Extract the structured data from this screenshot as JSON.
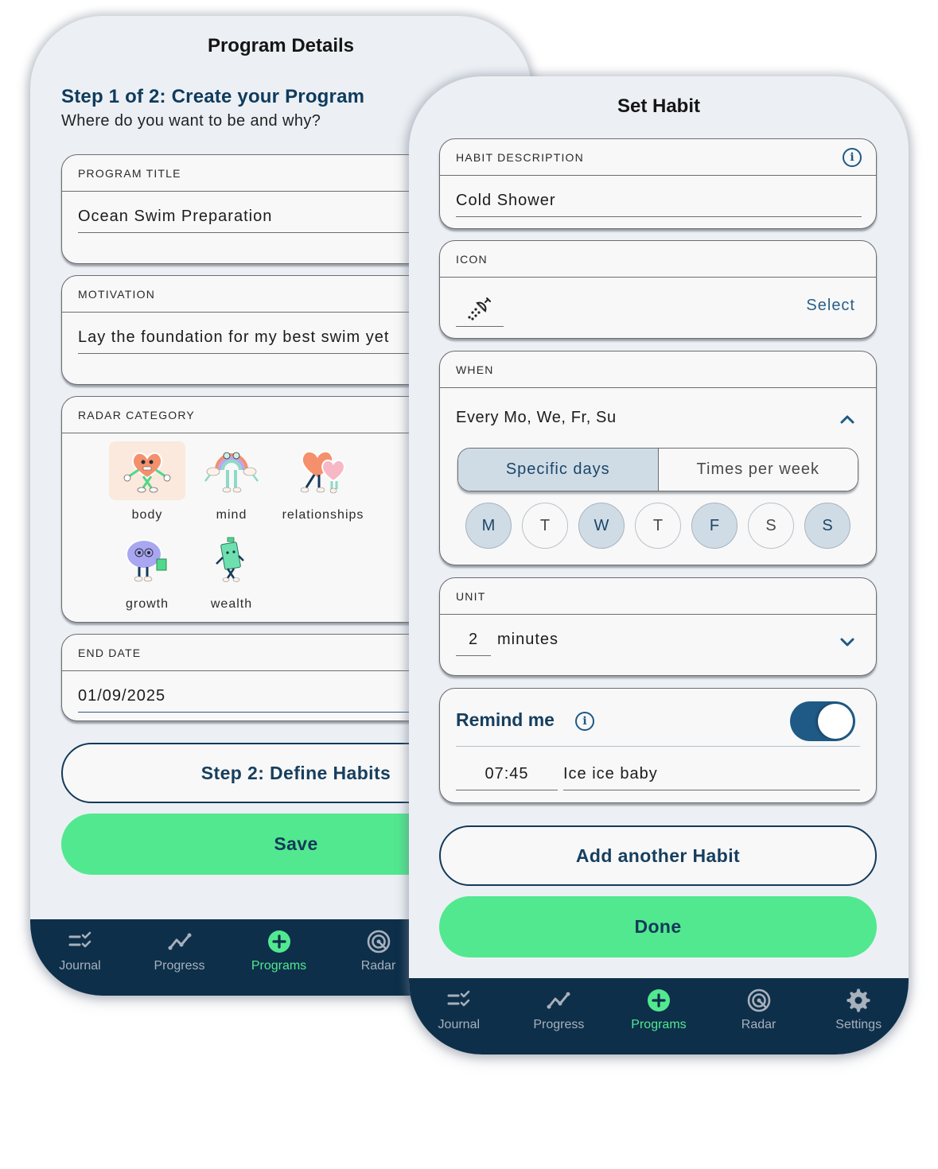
{
  "colors": {
    "accent_green": "#52e890",
    "navy": "#0d2f4a",
    "heading_blue": "#0f3b5c",
    "selected_fill": "#d0dce5",
    "toggle_on": "#1f5a86"
  },
  "program_details": {
    "title": "Program Details",
    "step_heading": "Step 1 of 2: Create your Program",
    "step_subheading": "Where do you want to be and why?",
    "program_title": {
      "label": "PROGRAM TITLE",
      "value": "Ocean Swim Preparation"
    },
    "motivation": {
      "label": "MOTIVATION",
      "value": "Lay the foundation for my best swim yet"
    },
    "radar_category": {
      "label": "RADAR CATEGORY",
      "selected": "body",
      "items": [
        {
          "label": "body",
          "icon": "heart-character-icon"
        },
        {
          "label": "mind",
          "icon": "rainbow-character-icon"
        },
        {
          "label": "relationships",
          "icon": "hugging-hearts-icon"
        },
        {
          "label": "growth",
          "icon": "brain-reading-icon"
        },
        {
          "label": "wealth",
          "icon": "money-character-icon"
        }
      ]
    },
    "end_date": {
      "label": "END DATE",
      "value": "01/09/2025"
    },
    "step2_button": "Step 2: Define Habits",
    "save_button": "Save",
    "tabs": [
      {
        "label": "Journal",
        "icon": "journal-checklist-icon",
        "active": false
      },
      {
        "label": "Progress",
        "icon": "progress-line-icon",
        "active": false
      },
      {
        "label": "Programs",
        "icon": "plus-circle-icon",
        "active": true
      },
      {
        "label": "Radar",
        "icon": "radar-target-icon",
        "active": false
      }
    ]
  },
  "set_habit": {
    "title": "Set Habit",
    "habit_description": {
      "label": "HABIT DESCRIPTION",
      "value": "Cold Shower"
    },
    "icon": {
      "label": "ICON",
      "current": "shower-icon",
      "select_label": "Select"
    },
    "when": {
      "label": "WHEN",
      "summary": "Every Mo, We, Fr, Su",
      "modes": [
        "Specific days",
        "Times per week"
      ],
      "active_mode": "Specific days",
      "days": [
        {
          "label": "M",
          "selected": true
        },
        {
          "label": "T",
          "selected": false
        },
        {
          "label": "W",
          "selected": true
        },
        {
          "label": "T",
          "selected": false
        },
        {
          "label": "F",
          "selected": true
        },
        {
          "label": "S",
          "selected": false
        },
        {
          "label": "S",
          "selected": true
        }
      ]
    },
    "unit": {
      "label": "UNIT",
      "amount": "2",
      "unit": "minutes"
    },
    "remind": {
      "label": "Remind me",
      "enabled": true,
      "time": "07:45",
      "message": "Ice ice baby"
    },
    "add_button": "Add another Habit",
    "done_button": "Done",
    "tabs": [
      {
        "label": "Journal",
        "icon": "journal-checklist-icon",
        "active": false
      },
      {
        "label": "Progress",
        "icon": "progress-line-icon",
        "active": false
      },
      {
        "label": "Programs",
        "icon": "plus-circle-icon",
        "active": true
      },
      {
        "label": "Radar",
        "icon": "radar-target-icon",
        "active": false
      },
      {
        "label": "Settings",
        "icon": "gear-icon",
        "active": false
      }
    ]
  }
}
